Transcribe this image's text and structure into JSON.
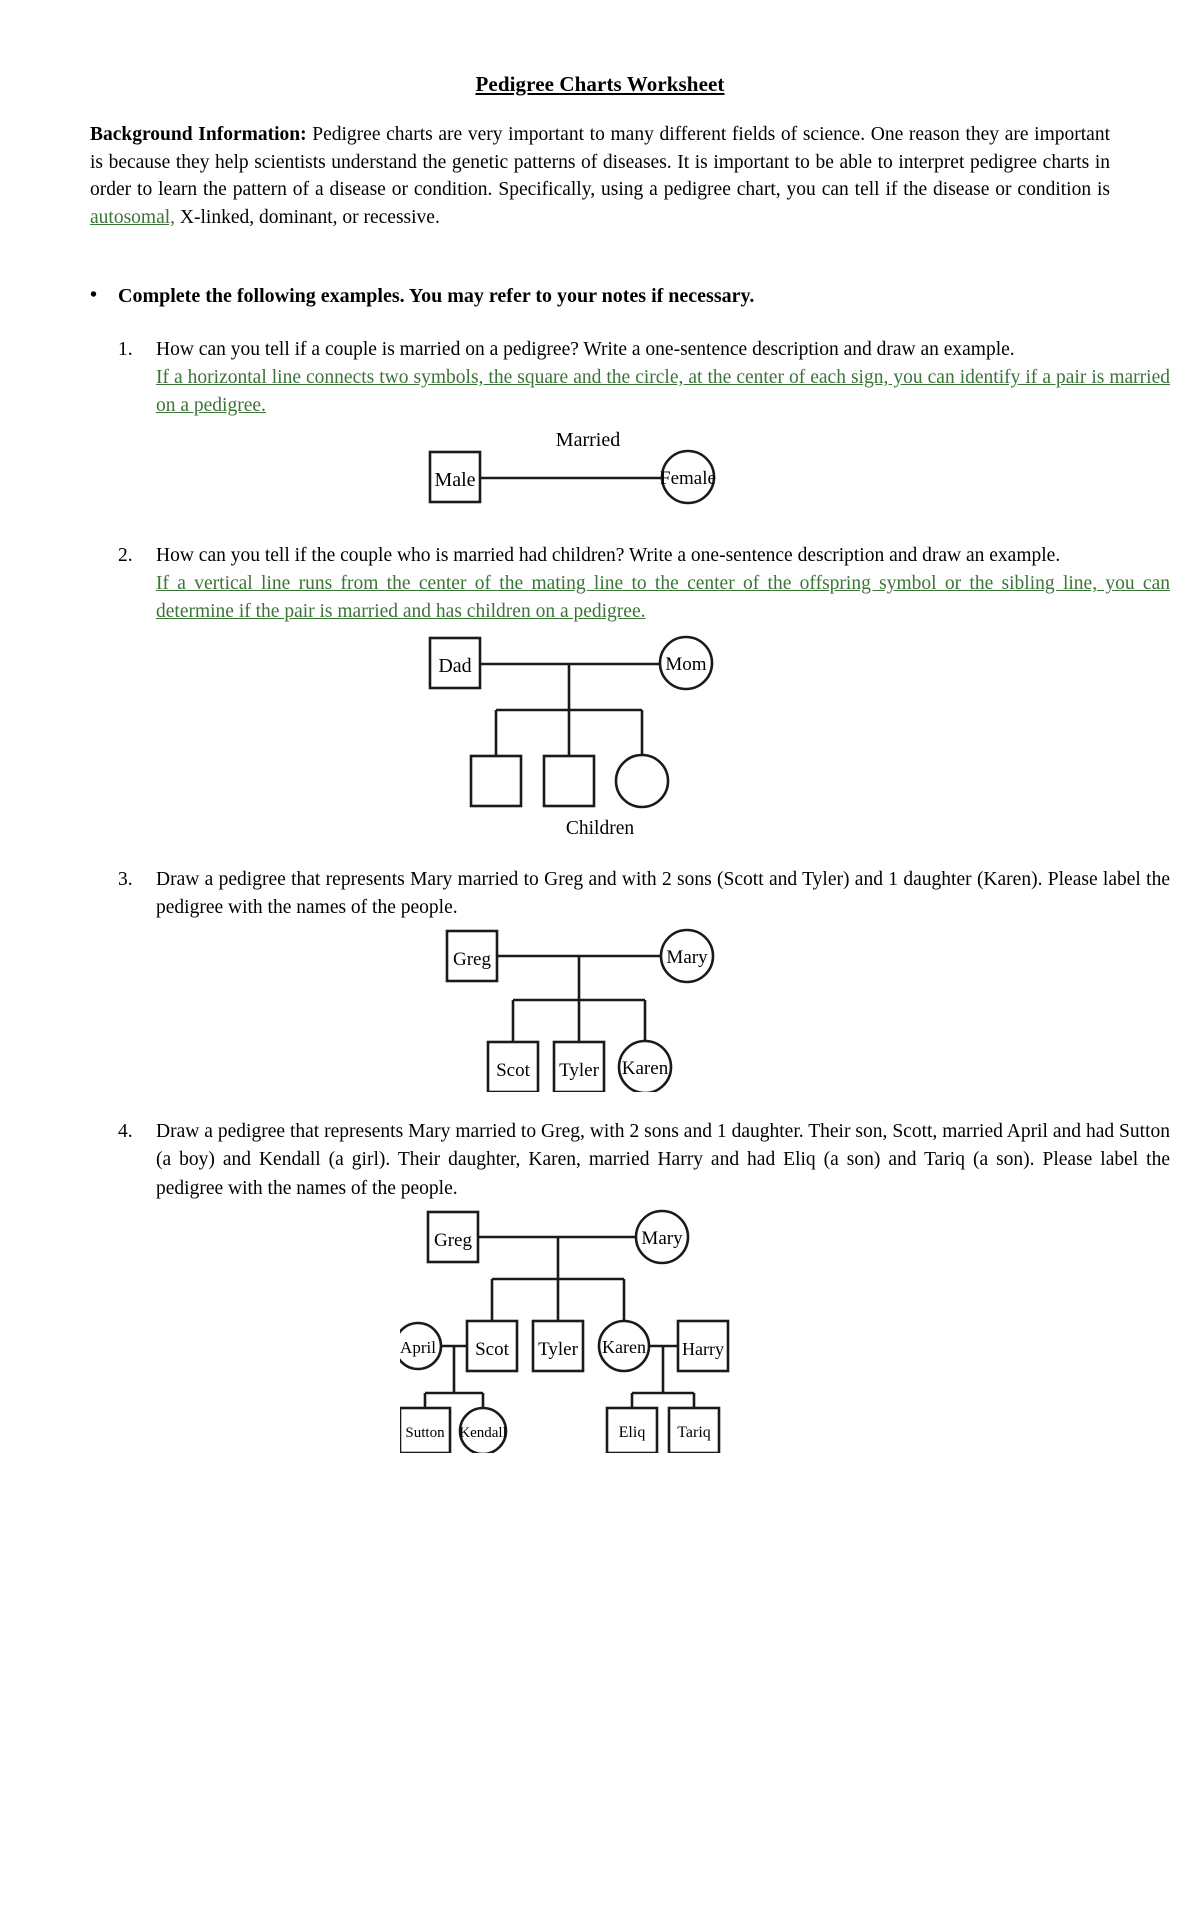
{
  "document": {
    "title": "Pedigree Charts Worksheet",
    "background_label": "Background Information:",
    "background_text_1": " Pedigree charts are very important to many different fields of science. One reason they are important is because they help scientists understand the genetic patterns of diseases. It is important to be able to interpret pedigree charts in order to learn the pattern of a disease or condition. Specifically, using a pedigree chart, you can tell if the disease or condition is ",
    "background_green_word": "autosomal,",
    "background_text_2": " X-linked, dominant, or recessive.",
    "bullet_instruction": "Complete the following examples. You may refer to your notes if necessary."
  },
  "questions": [
    {
      "number": "1.",
      "prompt": "How can you tell if a couple is married on a pedigree? Write a one-sentence description and draw an example.",
      "answer": "If a horizontal line connects two symbols, the square and the circle, at the center of each sign, you can identify if a pair is married on a pedigree."
    },
    {
      "number": "2.",
      "prompt": "How can you tell if the couple who is married had children? Write a one-sentence description and draw an example.",
      "answer": "If a vertical line runs from the center of the mating line to the center of the offspring symbol or the sibling line, you can determine if the pair is married and has children on a pedigree."
    },
    {
      "number": "3.",
      "prompt": "Draw a pedigree that represents Mary married to Greg and with 2 sons (Scott and Tyler) and 1 daughter (Karen). Please label the pedigree with the names of the people.",
      "answer": ""
    },
    {
      "number": "4.",
      "prompt": "Draw a pedigree that represents Mary married to Greg, with 2 sons and 1 daughter. Their son, Scott, married April and had Sutton (a boy) and Kendall (a girl). Their daughter, Karen, married Harry and had Eliq (a son) and Tariq (a son). Please label the pedigree with the names of the people.",
      "answer": ""
    }
  ],
  "pedigrees": {
    "figure1": {
      "male_label": "Male",
      "married_label": "Married",
      "female_label": "Female"
    },
    "figure2": {
      "dad_label": "Dad",
      "mom_label": "Mom",
      "children_caption": "Children"
    },
    "figure3": {
      "father_label": "Greg",
      "mother_label": "Mary",
      "child1_label": "Scot",
      "child2_label": "Tyler",
      "child3_label": "Karen"
    },
    "figure4": {
      "father_label": "Greg",
      "mother_label": "Mary",
      "spouse1_label": "April",
      "child1_label": "Scot",
      "child2_label": "Tyler",
      "child3_label": "Karen",
      "spouse2_label": "Harry",
      "grandchild1_label": "Sutton",
      "grandchild2_label": "Kendall",
      "grandchild3_label": "Eliq",
      "grandchild4_label": "Tariq"
    }
  },
  "colors": {
    "answer_green": "#3a7436",
    "ink": "#1a1a1a"
  }
}
